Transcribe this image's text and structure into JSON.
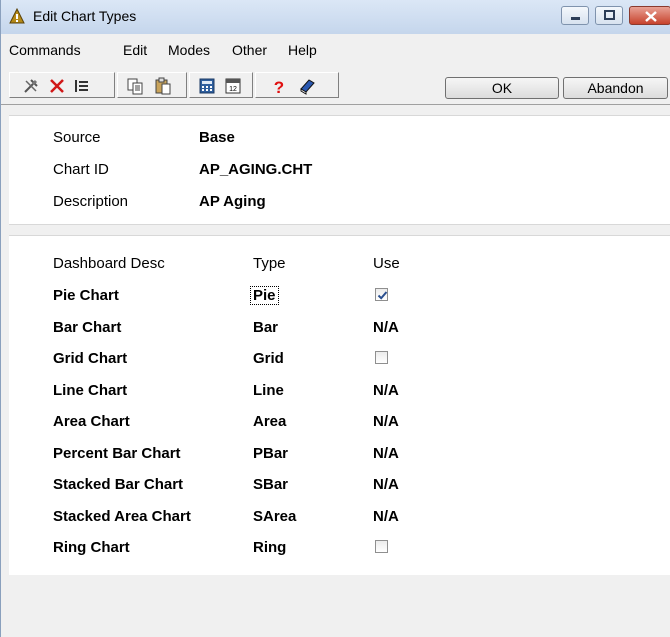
{
  "window": {
    "title": "Edit Chart Types"
  },
  "menu": [
    "Commands",
    "Edit",
    "Modes",
    "Other",
    "Help"
  ],
  "toolbar": {
    "ok_label": "OK",
    "abandon_label": "Abandon"
  },
  "header": {
    "source_label": "Source",
    "source_value": "Base",
    "chartid_label": "Chart ID",
    "chartid_value": "AP_AGING.CHT",
    "description_label": "Description",
    "description_value": "AP Aging"
  },
  "grid": {
    "columns": {
      "desc": "Dashboard Desc",
      "type": "Type",
      "use": "Use"
    },
    "rows": [
      {
        "desc": "Pie Chart",
        "type": "Pie",
        "use": "checked"
      },
      {
        "desc": "Bar Chart",
        "type": "Bar",
        "use": "N/A"
      },
      {
        "desc": "Grid Chart",
        "type": "Grid",
        "use": "unchecked"
      },
      {
        "desc": "Line Chart",
        "type": "Line",
        "use": "N/A"
      },
      {
        "desc": "Area Chart",
        "type": "Area",
        "use": "N/A"
      },
      {
        "desc": "Percent Bar Chart",
        "type": "PBar",
        "use": "N/A"
      },
      {
        "desc": "Stacked Bar Chart",
        "type": "SBar",
        "use": "N/A"
      },
      {
        "desc": "Stacked Area Chart",
        "type": "SArea",
        "use": "N/A"
      },
      {
        "desc": "Ring Chart",
        "type": "Ring",
        "use": "unchecked"
      }
    ]
  }
}
